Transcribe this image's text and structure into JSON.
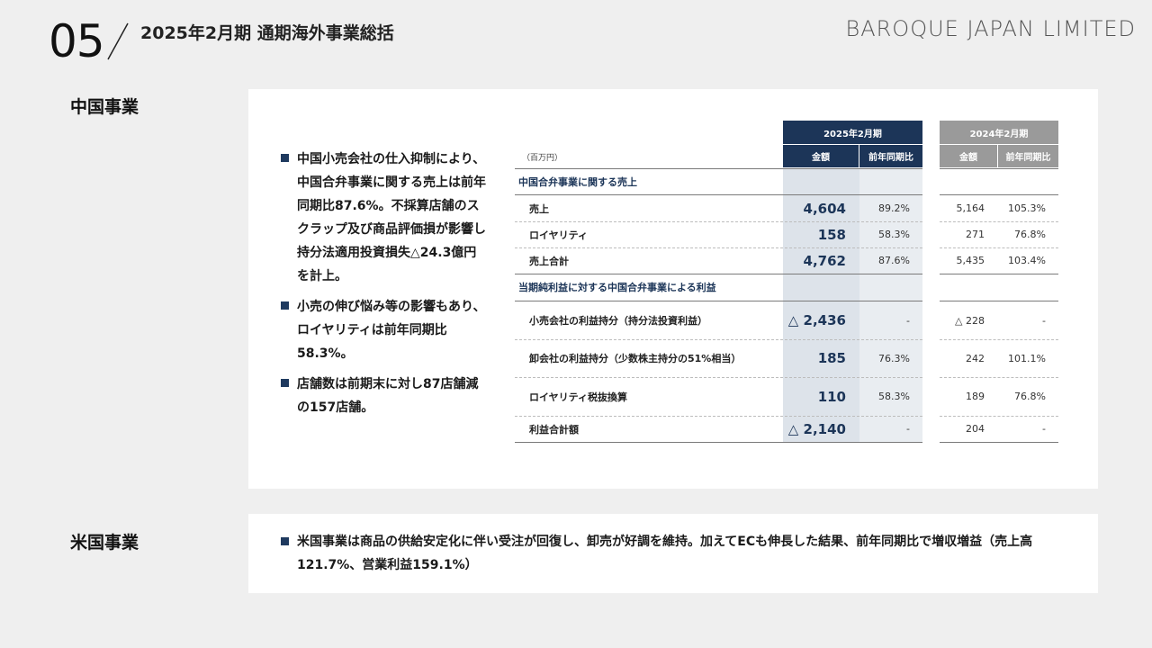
{
  "header": {
    "section_number": "05",
    "title": "2025年2月期 通期海外事業総括",
    "brand": "BAROQUE JAPAN LIMITED"
  },
  "china": {
    "label": "中国事業",
    "bullets": [
      "中国小売会社の仕入抑制により、中国合弁事業に関する売上は前年同期比87.6%。不採算店舗のスクラップ及び商品評価損が影響し持分法適用投資損失△24.3億円を計上。",
      "小売の伸び悩み等の影響もあり、ロイヤリティは前年同期比58.3%。",
      "店舗数は前期末に対し87店舗減の157店舗。"
    ],
    "table": {
      "unit": "（百万円）",
      "period_current": "2025年2月期",
      "period_prior": "2024年2月期",
      "col_amount": "金額",
      "col_yoy": "前年同期比",
      "section1": "中国合弁事業に関する売上",
      "section2": "当期純利益に対する中国合弁事業による利益",
      "rows": [
        {
          "label": "売上",
          "cur": "4,604",
          "cur_yoy": "89.2%",
          "prior": "5,164",
          "prior_yoy": "105.3%"
        },
        {
          "label": "ロイヤリティ",
          "cur": "158",
          "cur_yoy": "58.3%",
          "prior": "271",
          "prior_yoy": "76.8%"
        },
        {
          "label": "売上合計",
          "cur": "4,762",
          "cur_yoy": "87.6%",
          "prior": "5,435",
          "prior_yoy": "103.4%"
        },
        {
          "label": "小売会社の利益持分（持分法投資利益）",
          "cur": "△ 2,436",
          "cur_yoy": "-",
          "prior": "△ 228",
          "prior_yoy": "-"
        },
        {
          "label": "卸会社の利益持分（少数株主持分の51%相当）",
          "cur": "185",
          "cur_yoy": "76.3%",
          "prior": "242",
          "prior_yoy": "101.1%"
        },
        {
          "label": "ロイヤリティ税抜換算",
          "cur": "110",
          "cur_yoy": "58.3%",
          "prior": "189",
          "prior_yoy": "76.8%"
        },
        {
          "label": "利益合計額",
          "cur": "△ 2,140",
          "cur_yoy": "-",
          "prior": "204",
          "prior_yoy": "-"
        }
      ]
    }
  },
  "us": {
    "label": "米国事業",
    "bullet": "米国事業は商品の供給安定化に伴い受注が回復し、卸売が好調を維持。加えてECも伸長した結果、前年同期比で増収増益（売上高121.7%、営業利益159.1%）"
  },
  "colors": {
    "navy": "#1c3558",
    "grey_header": "#9a9a9a",
    "shade": "#dde3ea",
    "background": "#efefef"
  }
}
